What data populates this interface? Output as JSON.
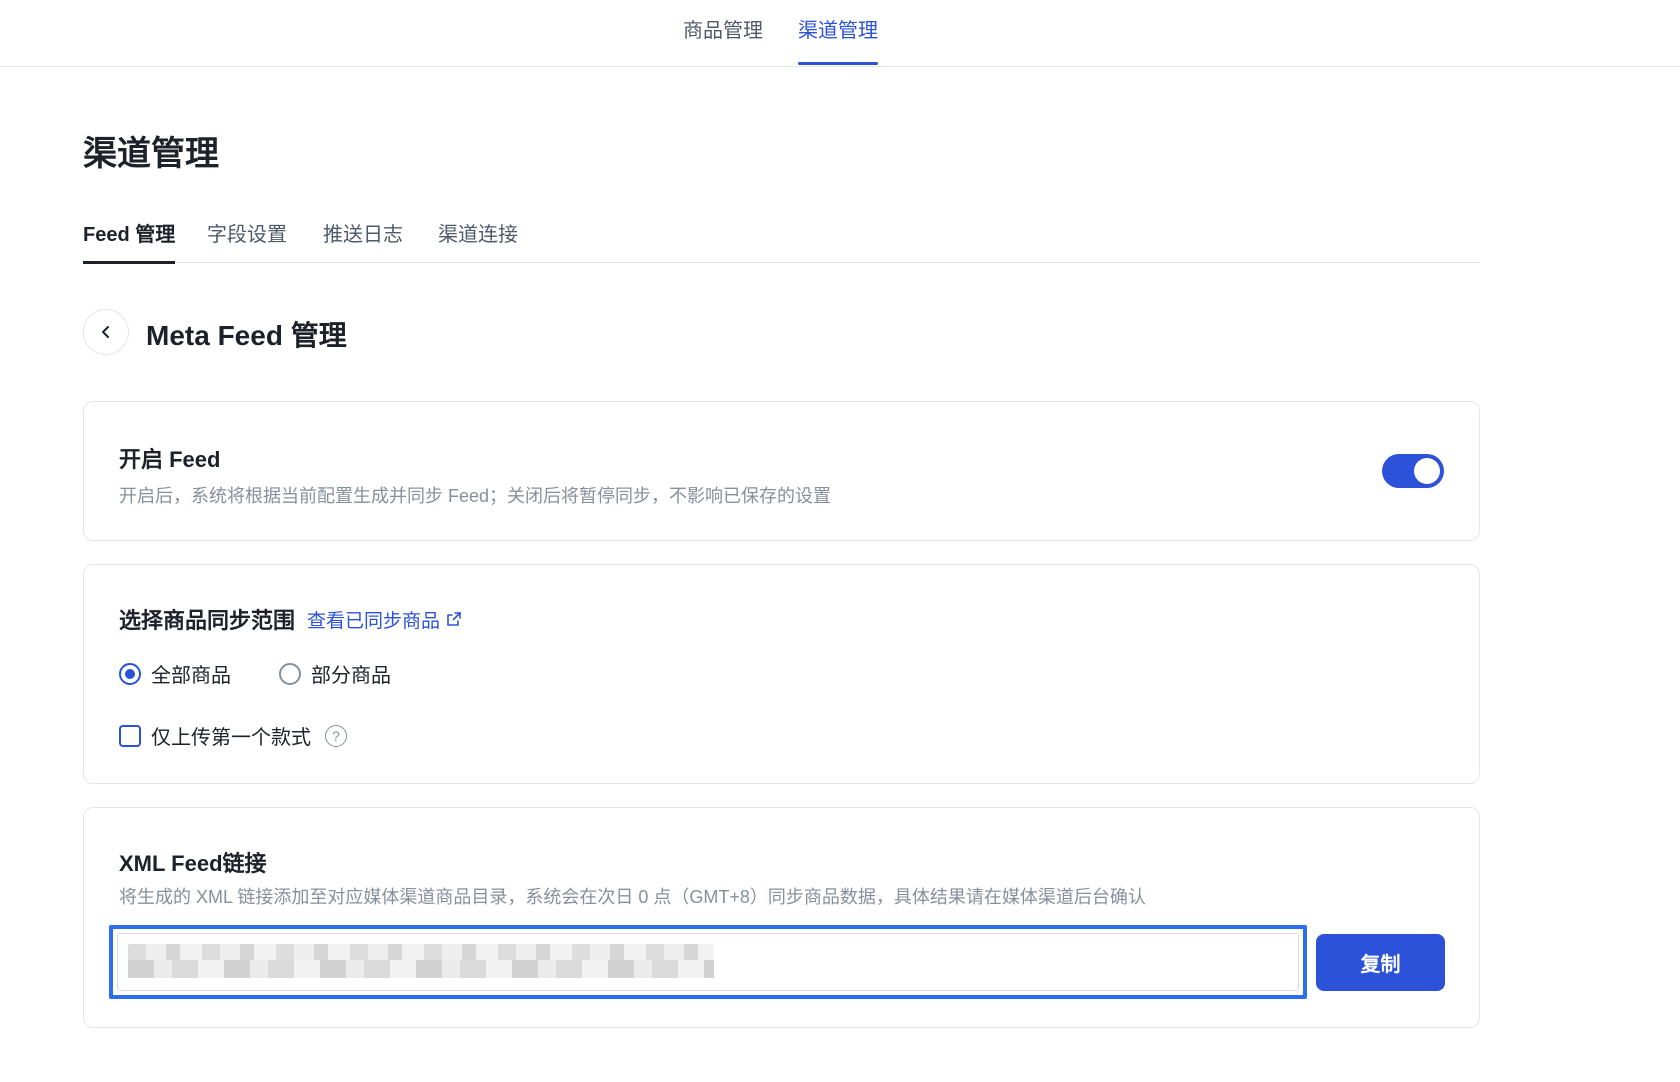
{
  "top_nav": {
    "tabs": [
      {
        "label": "商品管理",
        "active": false
      },
      {
        "label": "渠道管理",
        "active": true
      }
    ]
  },
  "page": {
    "title": "渠道管理"
  },
  "sub_tabs": [
    {
      "label": "Feed 管理",
      "active": true
    },
    {
      "label": "字段设置",
      "active": false
    },
    {
      "label": "推送日志",
      "active": false
    },
    {
      "label": "渠道连接",
      "active": false
    }
  ],
  "section": {
    "back_icon": "chevron-left-icon",
    "title": "Meta Feed 管理"
  },
  "feed_card": {
    "title": "开启 Feed",
    "description": "开启后，系统将根据当前配置生成并同步 Feed；关闭后将暂停同步，不影响已保存的设置",
    "enabled": true
  },
  "scope_card": {
    "title": "选择商品同步范围",
    "link_label": "查看已同步商品",
    "link_icon": "external-link-icon",
    "options": [
      {
        "label": "全部商品",
        "checked": true
      },
      {
        "label": "部分商品",
        "checked": false
      }
    ],
    "checkbox_label": "仅上传第一个款式",
    "checkbox_checked": false,
    "help_icon": "question-circle-icon"
  },
  "xml_card": {
    "title": "XML Feed链接",
    "description": "将生成的 XML 链接添加至对应媒体渠道商品目录，系统会在次日 0 点（GMT+8）同步商品数据，具体结果请在媒体渠道后台确认",
    "copy_label": "复制"
  },
  "colors": {
    "accent": "#2b52d9",
    "focus_ring": "#2b6ff0",
    "muted_text": "#86909c",
    "border": "#e5e6eb"
  }
}
